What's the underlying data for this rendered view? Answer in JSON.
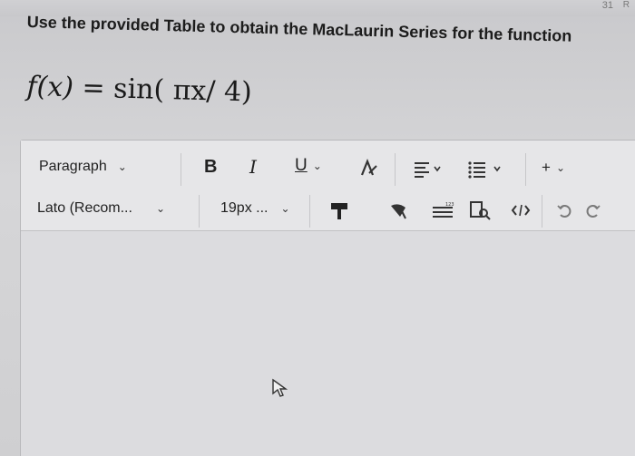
{
  "question": {
    "text": "Use the provided Table to obtain the MacLaurin Series for the function"
  },
  "formula": {
    "lhs": "f(x)",
    "equals": "=",
    "rhs": "sin( πx/ 4)"
  },
  "top_bar": {
    "right_text": "31",
    "corner_text": "R"
  },
  "toolbar": {
    "paragraph_label": "Paragraph",
    "font_label": "Lato (Recom...",
    "size_label": "19px ...",
    "bold_label": "B",
    "italic_label": "I",
    "underline_label": "U",
    "plus_label": "+"
  },
  "colors": {
    "background": "#d6d6d8",
    "editor_bg": "#e3e3e5",
    "undo_color": "#7a7a7a",
    "text": "#222222"
  }
}
